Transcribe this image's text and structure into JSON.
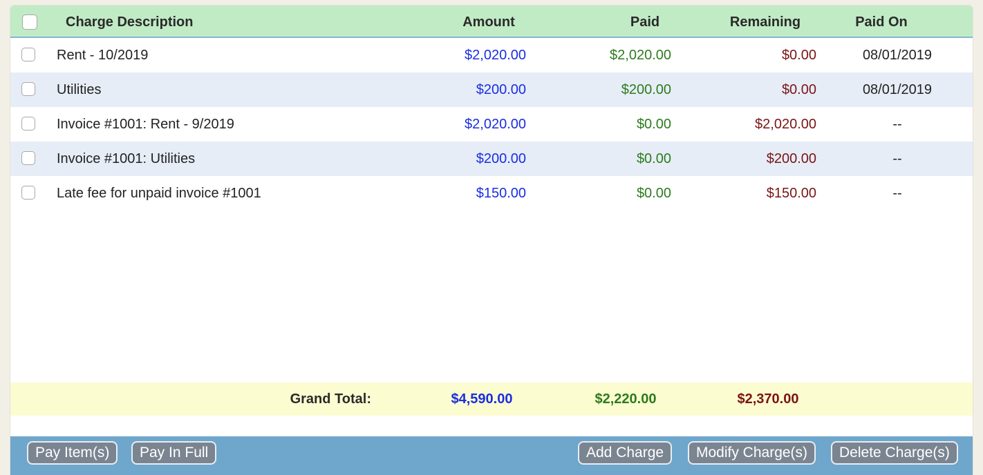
{
  "colors": {
    "header_bg": "#c1ebc5",
    "alt_row_bg": "#e6edf7",
    "totals_bg": "#fcfcd1",
    "toolbar_bg": "#6fa6cc",
    "button_bg": "#7b8591",
    "amount": "#1a2ee0",
    "paid": "#2d7b1d",
    "remaining": "#7a1414"
  },
  "table": {
    "columns": [
      "Charge Description",
      "Amount",
      "Paid",
      "Remaining",
      "Paid On"
    ],
    "rows": [
      {
        "description": "Rent - 10/2019",
        "amount": "$2,020.00",
        "paid": "$2,020.00",
        "remaining": "$0.00",
        "paid_on": "08/01/2019"
      },
      {
        "description": "Utilities",
        "amount": "$200.00",
        "paid": "$200.00",
        "remaining": "$0.00",
        "paid_on": "08/01/2019"
      },
      {
        "description": "Invoice #1001: Rent - 9/2019",
        "amount": "$2,020.00",
        "paid": "$0.00",
        "remaining": "$2,020.00",
        "paid_on": "--"
      },
      {
        "description": "Invoice #1001: Utilities",
        "amount": "$200.00",
        "paid": "$0.00",
        "remaining": "$200.00",
        "paid_on": "--"
      },
      {
        "description": "Late fee for unpaid invoice #1001",
        "amount": "$150.00",
        "paid": "$0.00",
        "remaining": "$150.00",
        "paid_on": "--"
      }
    ]
  },
  "totals": {
    "label": "Grand Total:",
    "amount": "$4,590.00",
    "paid": "$2,220.00",
    "remaining": "$2,370.00"
  },
  "toolbar": {
    "pay_items": "Pay Item(s)",
    "pay_in_full": "Pay In Full",
    "add_charge": "Add Charge",
    "modify_charges": "Modify Charge(s)",
    "delete_charges": "Delete Charge(s)"
  }
}
